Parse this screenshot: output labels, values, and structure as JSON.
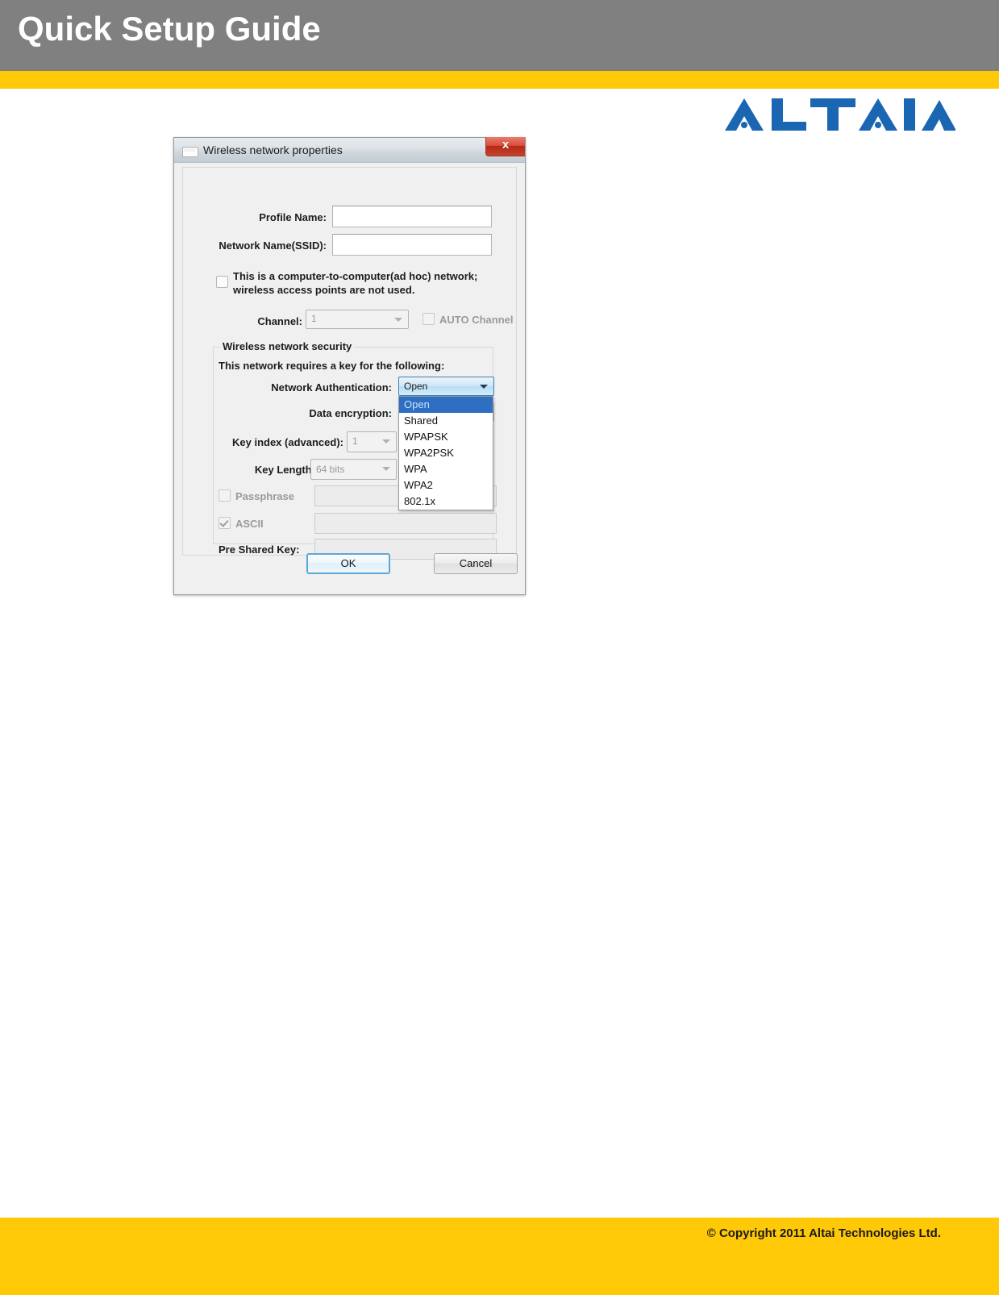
{
  "header": {
    "title": "Quick Setup Guide",
    "stripe_color": "#ffc907",
    "bg_color": "#808080"
  },
  "logo": {
    "name": "ALTAI",
    "color": "#1b66b3"
  },
  "footer": {
    "copyright": "© Copyright 2011 Altai Technologies Ltd.",
    "bg_color": "#ffc907"
  },
  "dialog": {
    "title": "Wireless network properties",
    "close_label": "x",
    "fields": {
      "profile_name_label": "Profile Name:",
      "profile_name_value": "",
      "ssid_label": "Network Name(SSID):",
      "ssid_value": "",
      "adhoc_label": "This is a computer-to-computer(ad hoc) network; wireless access points are not used.",
      "adhoc_checked": false,
      "channel_label": "Channel:",
      "channel_value": "1",
      "auto_channel_label": "AUTO Channel",
      "auto_channel_checked": false
    },
    "security": {
      "group_title": "Wireless network security",
      "requires_key_text": "This network requires a key for the following:",
      "network_auth_label": "Network Authentication:",
      "network_auth_value": "Open",
      "network_auth_options": [
        "Open",
        "Shared",
        "WPAPSK",
        "WPA2PSK",
        "WPA",
        "WPA2",
        "802.1x"
      ],
      "network_auth_selected_index": 0,
      "data_encryption_label": "Data encryption:",
      "data_encryption_value": "",
      "key_index_label": "Key index (advanced):",
      "key_index_value": "1",
      "key_length_label": "Key Length:",
      "key_length_value": "64 bits",
      "passphrase_label": "Passphrase",
      "passphrase_checked": false,
      "passphrase_value": "",
      "ascii_label": "ASCII",
      "ascii_checked": true,
      "ascii_value": "",
      "pre_shared_key_label": "Pre Shared Key:",
      "pre_shared_key_value": ""
    },
    "buttons": {
      "ok_label": "OK",
      "cancel_label": "Cancel"
    }
  }
}
